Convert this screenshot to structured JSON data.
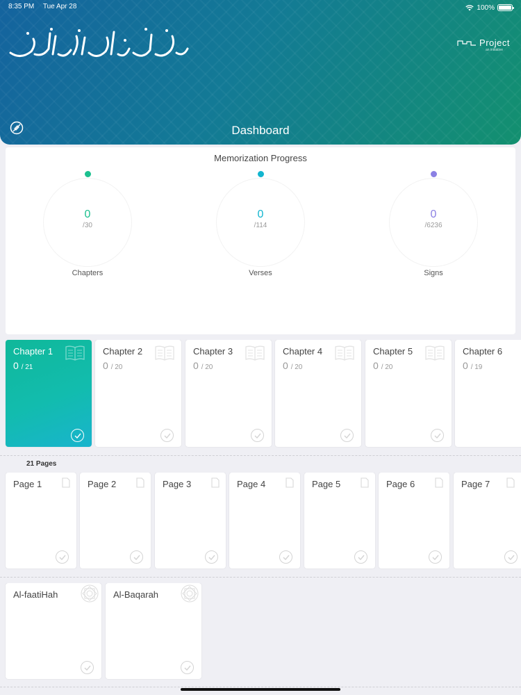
{
  "status_bar": {
    "time": "8:35 PM",
    "date": "Tue Apr 28",
    "battery": "100%"
  },
  "header": {
    "title": "Dashboard",
    "calligraphy_icon": "arabic-calligraphy-icon",
    "settings_icon": "brush-off-icon",
    "logo_text": "Project",
    "logo_tagline": "an initiative"
  },
  "progress": {
    "title": "Memorization Progress",
    "stats": [
      {
        "label": "Chapters",
        "value": "0",
        "total": "/30",
        "color": "#1cc08f"
      },
      {
        "label": "Verses",
        "value": "0",
        "total": "/114",
        "color": "#12b5cf"
      },
      {
        "label": "Signs",
        "value": "0",
        "total": "/6236",
        "color": "#8b80e3"
      }
    ]
  },
  "chapters": [
    {
      "label": "Chapter 1",
      "done": "0",
      "total": "/ 21",
      "active": true
    },
    {
      "label": "Chapter 2",
      "done": "0",
      "total": "/ 20"
    },
    {
      "label": "Chapter 3",
      "done": "0",
      "total": "/ 20"
    },
    {
      "label": "Chapter 4",
      "done": "0",
      "total": "/ 20"
    },
    {
      "label": "Chapter 5",
      "done": "0",
      "total": "/ 20"
    },
    {
      "label": "Chapter 6",
      "done": "0",
      "total": "/ 19"
    }
  ],
  "pages_heading": "21 Pages",
  "pages": [
    "Page 1",
    "Page 2",
    "Page 3",
    "Page 4",
    "Page 5",
    "Page 6",
    "Page 7"
  ],
  "surahs": [
    "Al-faatiHah",
    "Al-Baqarah"
  ],
  "colors": {
    "header_start": "#14639e",
    "header_end": "#13906f",
    "active_card": "#12bcae"
  }
}
